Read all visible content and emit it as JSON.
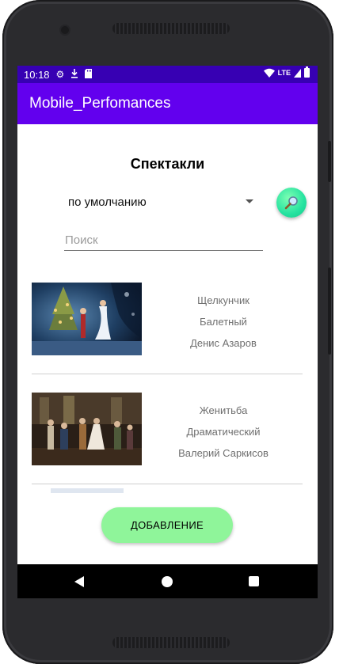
{
  "status_bar": {
    "time": "10:18",
    "icons": [
      "gear-icon",
      "download-icon",
      "sd-card-icon"
    ],
    "network": "LTE"
  },
  "app_bar": {
    "title": "Mobile_Perfomances"
  },
  "main": {
    "heading": "Спектакли",
    "sort_spinner": {
      "selected": "по умолчанию"
    },
    "search": {
      "placeholder": "Поиск",
      "value": ""
    },
    "performances": [
      {
        "title": "Щелкунчик",
        "genre": "Балетный",
        "director": "Денис Азаров"
      },
      {
        "title": "Женитьба",
        "genre": "Драматический",
        "director": "Валерий Саркисов"
      }
    ],
    "add_button_label": "ДОБАВЛЕНИЕ"
  },
  "colors": {
    "status_bar": "#3700b3",
    "app_bar": "#6200ee",
    "search_fab": "#25e2a0",
    "add_button": "#8ff59a"
  }
}
